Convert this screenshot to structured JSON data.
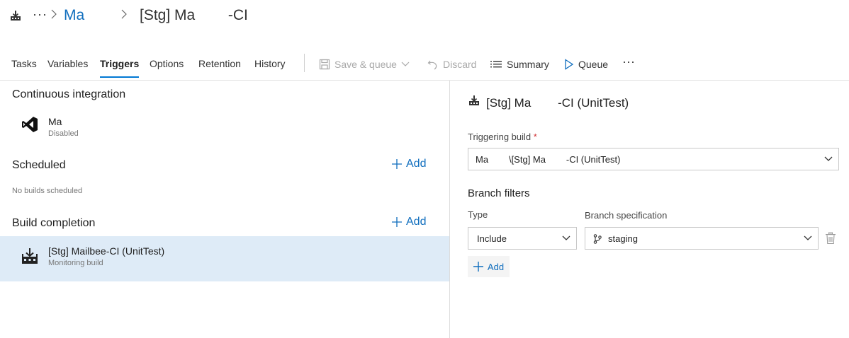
{
  "breadcrumb": {
    "more": "···",
    "project": "Ma",
    "pipeline_title": "[Stg] Ma        -CI"
  },
  "toolbar": {
    "tabs": [
      {
        "label": "Tasks"
      },
      {
        "label": "Variables"
      },
      {
        "label": "Triggers"
      },
      {
        "label": "Options"
      },
      {
        "label": "Retention"
      },
      {
        "label": "History"
      }
    ],
    "active_tab": "Triggers",
    "save_queue": "Save & queue",
    "discard": "Discard",
    "summary": "Summary",
    "queue": "Queue",
    "more": "···"
  },
  "left": {
    "ci": {
      "title": "Continuous integration",
      "item_name": "Ma",
      "item_status": "Disabled"
    },
    "scheduled": {
      "title": "Scheduled",
      "add_label": "Add",
      "empty_text": "No builds scheduled"
    },
    "build_completion": {
      "title": "Build completion",
      "add_label": "Add",
      "item_name": "[Stg] Mailbee-CI (UnitTest)",
      "item_status": "Monitoring build"
    }
  },
  "right": {
    "title": "[Stg] Ma        -CI (UnitTest)",
    "triggering_build_label": "Triggering build",
    "required_mark": "*",
    "triggering_build_value": "Ma        \\[Stg] Ma        -CI (UnitTest)",
    "branch_filters_label": "Branch filters",
    "type_label": "Type",
    "type_value": "Include",
    "branch_spec_label": "Branch specification",
    "branch_spec_value": "staging",
    "add_label": "Add"
  },
  "colors": {
    "accent": "#106ebe",
    "active_tab_underline": "#0078d4",
    "selected_row": "#deebf7",
    "required": "#d13438"
  },
  "icons": {
    "pipeline": "build-pipeline-icon",
    "vs": "visual-studio-icon",
    "save": "save-icon",
    "discard": "undo-icon",
    "summary": "list-icon",
    "queue": "play-icon",
    "branch": "branch-icon",
    "delete": "trash-icon",
    "add": "plus-icon"
  }
}
